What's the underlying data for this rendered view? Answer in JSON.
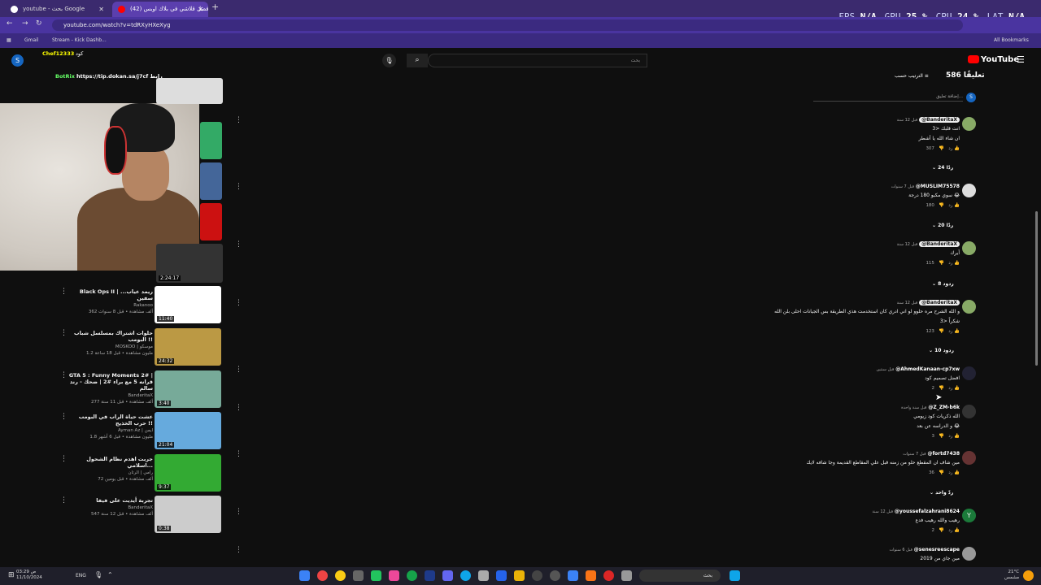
{
  "browser": {
    "tabs": [
      {
        "label": "youtube - ‏بحث Google"
      },
      {
        "label": "(42) أفضل قلاشي في بلاك اوبس"
      }
    ],
    "url": "youtube.com/watch?v=tdRXyHXeXyg",
    "bookmarks": [
      "Gmail",
      "Stream - Kick Dashb...",
      "All Bookmarks"
    ],
    "new_tab": "+"
  },
  "perf_overlay": {
    "fps_label": "FPS",
    "fps_value": "N/A",
    "gpu_label": "GPU",
    "gpu_value": "25 %",
    "cpu_label": "CPU",
    "cpu_value": "24 %",
    "lat_label": "LAT",
    "lat_value": "N/A"
  },
  "stream_overlay": {
    "chat1_name": "Chef12333",
    "chat1_text": "كود",
    "chat2_name": "BotRix",
    "chat2_text": "https://tip.dokan.sa/j7cf رابط"
  },
  "youtube": {
    "logo": "YouTube",
    "avatar_letter": "S",
    "search_placeholder": "بحث",
    "comment_count": "586 تعليقًا",
    "sort_label": "الترتيب حسب",
    "add_comment_placeholder": "إضافة تعليق..."
  },
  "related": [
    {
      "title": "Black Ops II | ...ريمد عياب سفين",
      "channel": "Rakanoo",
      "meta": "362 ألف مشاهدة • قبل 8 سنوات",
      "duration": "11:40"
    },
    {
      "title": "حلوات اشتراك بمسلسل شباب البومب !!",
      "channel": "MOSKOO | موسكو",
      "meta": "1.2 مليون مشاهدة • قبل 18 ساعة",
      "duration": "24:32"
    },
    {
      "title": "GTA 5 : Funny Moments 2# | قرانه 5 مع براء #2 | ضحك - رند سالم",
      "channel": "BanderitaX",
      "meta": "277 ألف مشاهدة • قبل 11 سنة",
      "duration": "3:40"
    },
    {
      "title": "عشت حياة الراب في البومب حرب الخذيج !!",
      "channel": "Ayman Az | ايمن",
      "meta": "1.8 مليون مشاهدة • قبل 6 أشهر",
      "duration": "21:04"
    },
    {
      "title": "جربت اهدم نظام الشحول اسلامي...",
      "channel": "رامي | الرتان",
      "meta": "72 ألف مشاهدة • قبل يومين",
      "duration": "9:37"
    },
    {
      "title": "تجربة أيديت على فيفا",
      "channel": "BanderitaX",
      "meta": "547 ألف مشاهدة • قبل 12 سنة",
      "duration": "0:38"
    }
  ],
  "top_video_duration": "2:24:17",
  "comments": [
    {
      "handle": "@BanderitaX",
      "creator": true,
      "time": "قبل 12 سنة",
      "text": "انت قلبك <3",
      "text2": "ان شاء الله يا أشطر",
      "likes": "307",
      "replies": "24 ردًا"
    },
    {
      "handle": "@MUSLIM75578",
      "creator": false,
      "time": "قبل 7 سنوات",
      "text": "سوي مكبو 180 درجة 😂",
      "text2": "",
      "likes": "180",
      "replies": "20 ردًا"
    },
    {
      "handle": "@BanderitaX",
      "creator": true,
      "time": "قبل 12 سنة",
      "text": "أيرك",
      "text2": "",
      "likes": "115",
      "replies": "8 ردود"
    },
    {
      "handle": "@BanderitaX",
      "creator": true,
      "time": "قبل 12 سنة",
      "text": "و الله الشرح مره حلوو لو اني ادري كان استخدمت هذي الطريقة بس الجيانات احلى بلن الله",
      "text2": "شكراً <3",
      "likes": "123",
      "replies": "10 ردود"
    },
    {
      "handle": "@AhmedKanaan-cp7xw",
      "creator": false,
      "time": "قبل سنتين",
      "text": "افضل تصميم كود",
      "text2": "",
      "likes": "2",
      "replies": ""
    },
    {
      "handle": "@Z_ZM-b6k",
      "creator": false,
      "time": "قبل سنة واحدة",
      "text": "الله ذكريات كود زيومي",
      "text2": "و الدراسه عن بعد 😂",
      "likes": "3",
      "replies": ""
    },
    {
      "handle": "@fortd7438",
      "creator": false,
      "time": "قبل 7 سنوات",
      "text": "مين شاف ان المقطع حلو من زمنه قبل علي المقاطع القديمة وجا شافه لايك",
      "text2": "",
      "likes": "36",
      "replies": "ردّ واحد"
    },
    {
      "handle": "@youssefalzahrani8624",
      "creator": false,
      "time": "قبل 12 سنة",
      "text": "رهيب والله رهيب فدع",
      "text2": "",
      "likes": "2",
      "replies": ""
    },
    {
      "handle": "@senesreescape",
      "creator": false,
      "time": "قبل 6 سنوات",
      "text": "مين جاي من 2019",
      "text2": "",
      "likes": "",
      "replies": ""
    }
  ],
  "reply_label": "رد",
  "taskbar": {
    "search": "بحث",
    "lang": "ENG",
    "temp": "21°C",
    "weather": "مشمس",
    "time": "03:29 ص",
    "date": "11/10/2024"
  },
  "colors": {
    "tab_bg": "#3b2a6e",
    "yt_red": "#ff0000",
    "bg": "#0f0f0f"
  }
}
